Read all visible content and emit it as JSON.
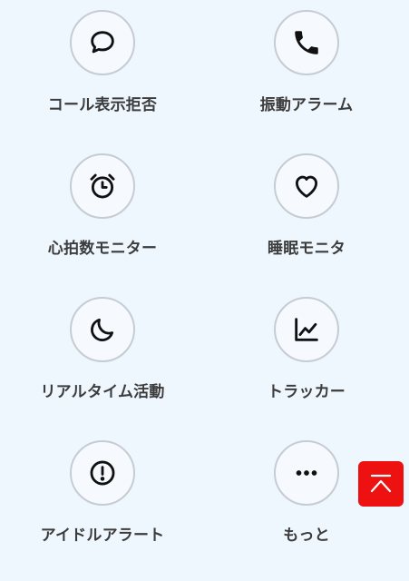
{
  "features": [
    {
      "label": "コール表示拒否",
      "icon": "chat-bubble-icon"
    },
    {
      "label": "振動アラーム",
      "icon": "phone-icon"
    },
    {
      "label": "心拍数モニター",
      "icon": "alarm-clock-icon"
    },
    {
      "label": "睡眠モニタ",
      "icon": "heart-icon"
    },
    {
      "label": "リアルタイム活動",
      "icon": "moon-icon"
    },
    {
      "label": "トラッカー",
      "icon": "chart-icon"
    },
    {
      "label": "アイドルアラート",
      "icon": "alert-icon"
    },
    {
      "label": "もっと",
      "icon": "more-icon"
    }
  ],
  "scroll_top": {
    "icon": "scroll-to-top-icon"
  },
  "colors": {
    "background": "#eef6fe",
    "icon_border": "#c6ccd4",
    "text": "#3c3c3c",
    "scroll_top_bg": "#ee1111"
  }
}
